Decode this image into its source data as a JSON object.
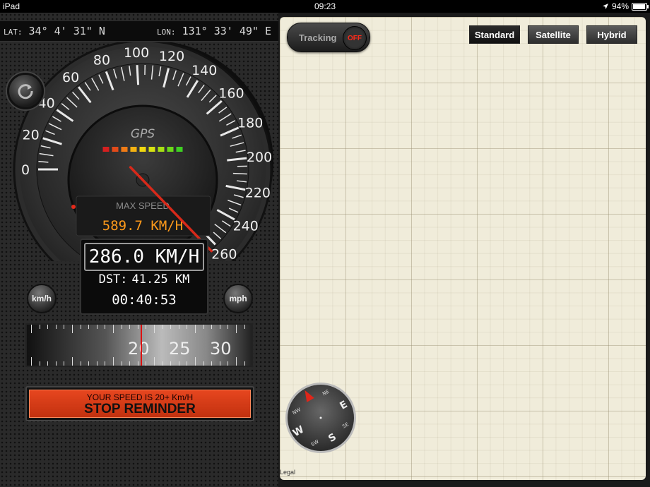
{
  "status_bar": {
    "device": "iPad",
    "time": "09:23",
    "battery": "94%",
    "battery_level": 0.94
  },
  "coords": {
    "lat_label": "LAT:",
    "lat_value": "34° 4' 31\" N",
    "lon_label": "LON:",
    "lon_value": "131° 33' 49\" E"
  },
  "gauge": {
    "brand": "GPS",
    "scale_labels": [
      "0",
      "20",
      "40",
      "60",
      "80",
      "100",
      "120",
      "140",
      "160",
      "180",
      "200",
      "220",
      "240",
      "260"
    ],
    "scale_min": 0,
    "scale_max": 260,
    "max_speed_label": "MAX SPEED",
    "max_speed_value": "589.7 KM/H",
    "needle_value": 260,
    "led_colors": [
      "#d42020",
      "#e24a1a",
      "#ef7b16",
      "#f4b212",
      "#f0d810",
      "#d6e312",
      "#a6e014",
      "#6ad81a",
      "#3ed022"
    ]
  },
  "readout": {
    "speed": "286.0 KM/H",
    "distance_label": "DST:",
    "distance_value": "41.25 KM",
    "elapsed": "00:40:53"
  },
  "units": {
    "kmh": "km/h",
    "mph": "mph"
  },
  "ruler": {
    "labels": [
      "20",
      "25",
      "30"
    ]
  },
  "reminder": {
    "line1": "YOUR SPEED IS 20+ Km/H",
    "line2": "STOP REMINDER"
  },
  "map": {
    "tracking_label": "Tracking",
    "tracking_state": "OFF",
    "types": [
      "Standard",
      "Satellite",
      "Hybrid"
    ],
    "active_type": "Standard",
    "legal": "Legal",
    "compass": {
      "N": "N",
      "NE": "NE",
      "E": "E",
      "SE": "SE",
      "S": "S",
      "SW": "SW",
      "W": "W",
      "NW": "NW"
    }
  },
  "colors": {
    "accent_red": "#d8291a",
    "max_speed_text": "#ff9a1a",
    "map_bg": "#f0ecda"
  }
}
